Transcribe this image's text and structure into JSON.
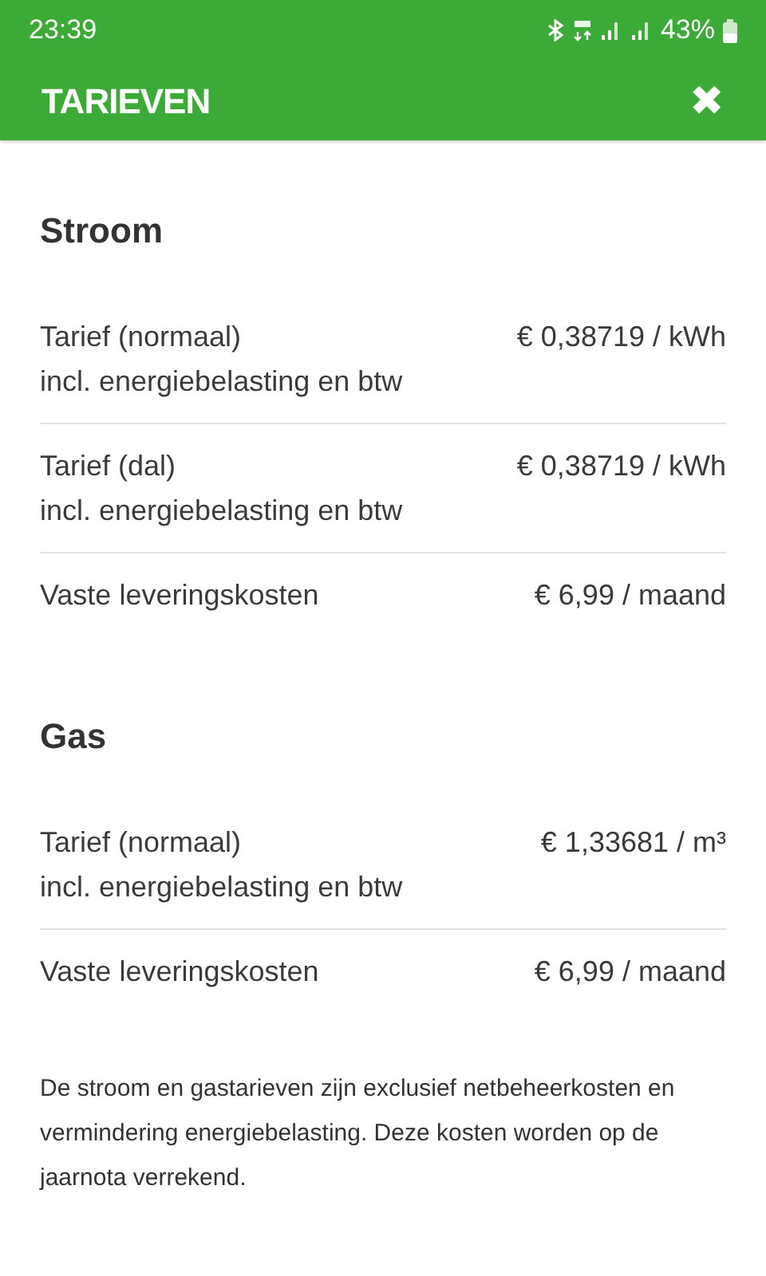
{
  "status_bar": {
    "time": "23:39",
    "battery": "43%"
  },
  "header": {
    "title": "TARIEVEN",
    "close": "✖"
  },
  "sections": [
    {
      "title": "Stroom",
      "rows": [
        {
          "label": "Tarief (normaal)",
          "sublabel": "incl. energiebelasting en btw",
          "price": "€ 0,38719 / kWh"
        },
        {
          "label": "Tarief (dal)",
          "sublabel": "incl. energiebelasting en btw",
          "price": "€ 0,38719 / kWh"
        },
        {
          "label": "Vaste leveringskosten",
          "price": "€ 6,99 / maand"
        }
      ]
    },
    {
      "title": "Gas",
      "rows": [
        {
          "label": "Tarief (normaal)",
          "sublabel": "incl. energiebelasting en btw",
          "price": "€ 1,33681 / m³"
        },
        {
          "label": "Vaste leveringskosten",
          "price": "€ 6,99 / maand"
        }
      ]
    }
  ],
  "footnote": "De stroom en gastarieven zijn exclusief netbeheerkosten en vermindering energiebelasting. Deze kosten worden op de jaarnota verrekend."
}
